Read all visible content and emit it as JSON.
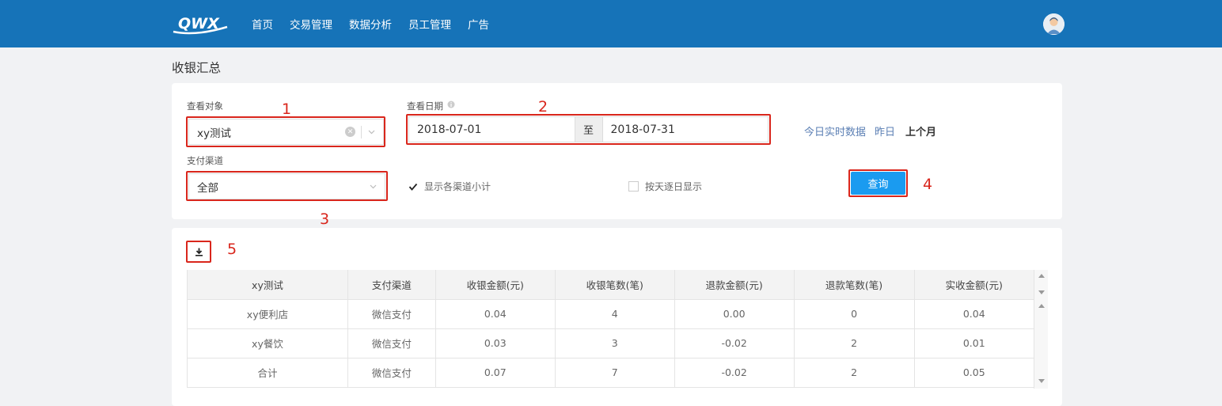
{
  "header": {
    "logo_text": "QWX",
    "nav": [
      "首页",
      "交易管理",
      "数据分析",
      "员工管理",
      "广告"
    ]
  },
  "page_title": "收银汇总",
  "filters": {
    "target_label": "查看对象",
    "target_value": "xy测试",
    "date_label": "查看日期",
    "date_start": "2018-07-01",
    "date_sep": "至",
    "date_end": "2018-07-31",
    "quick_links": [
      "今日实时数据",
      "昨日",
      "上个月"
    ],
    "channel_label": "支付渠道",
    "channel_value": "全部",
    "show_subtotal_label": "显示各渠道小计",
    "show_subtotal_checked": true,
    "daily_label": "按天逐日显示",
    "daily_checked": false,
    "query_button": "查询"
  },
  "annotations": [
    "1",
    "2",
    "3",
    "4",
    "5"
  ],
  "table": {
    "headers": [
      "xy测试",
      "支付渠道",
      "收银金额(元)",
      "收银笔数(笔)",
      "退款金额(元)",
      "退款笔数(笔)",
      "实收金额(元)"
    ],
    "rows": [
      [
        "xy便利店",
        "微信支付",
        "0.04",
        "4",
        "0.00",
        "0",
        "0.04"
      ],
      [
        "xy餐饮",
        "微信支付",
        "0.03",
        "3",
        "-0.02",
        "2",
        "0.01"
      ],
      [
        "合计",
        "微信支付",
        "0.07",
        "7",
        "-0.02",
        "2",
        "0.05"
      ]
    ]
  },
  "colors": {
    "header_bg": "#1673b8",
    "accent": "#1a9bf0",
    "annotation": "#d9261c"
  }
}
